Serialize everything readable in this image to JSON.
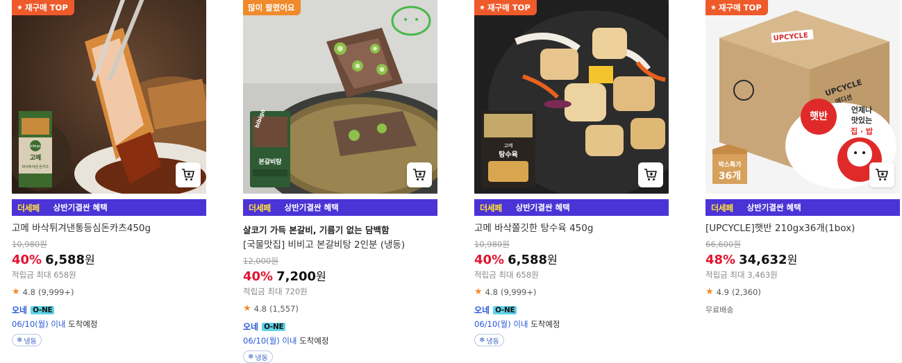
{
  "products": [
    {
      "badge": "재구매 TOP",
      "promo_logo": "더세페",
      "promo_text": "상반기결싼 혜택",
      "title": "고메 바삭튀겨낸통등심돈카츠450g",
      "original_price": "10,980원",
      "discount": "40%",
      "price": "6,588",
      "won": "원",
      "points": "적립금 최대 658원",
      "rating": "4.8",
      "reviews": "(9,999+)",
      "one_label": "오네",
      "one_logo": "O-NE",
      "arrival_date": "06/10(월) 이내",
      "arrival_rest": "도착예정",
      "frozen": "냉동",
      "image_text": [
        "bibigo",
        "고메",
        "바삭튀겨낸 돈카츠"
      ]
    },
    {
      "badge": "많이 팔렸어요",
      "promo_logo": "더세페",
      "promo_text": "상반기결싼 혜택",
      "subtitle": "살코기 가득 본갈비, 기름기 없는 담백함",
      "title": "[국물맛집] 비비고 본갈비탕 2인분 (냉동)",
      "original_price": "12,000원",
      "discount": "40%",
      "price": "7,200",
      "won": "원",
      "points": "적립금 최대 720원",
      "rating": "4.8",
      "reviews": "(1,557)",
      "one_label": "오네",
      "one_logo": "O-NE",
      "arrival_date": "06/10(월) 이내",
      "arrival_rest": "도착예정",
      "frozen": "냉동",
      "image_text": [
        "bibigo",
        "본갈비탕"
      ]
    },
    {
      "badge": "재구매 TOP",
      "promo_logo": "더세페",
      "promo_text": "상반기결싼 혜택",
      "title": "고메 바삭쫄깃한 탕수육 450g",
      "original_price": "10,980원",
      "discount": "40%",
      "price": "6,588",
      "won": "원",
      "points": "적립금 최대 658원",
      "rating": "4.8",
      "reviews": "(9,999+)",
      "one_label": "오네",
      "one_logo": "O-NE",
      "arrival_date": "06/10(월) 이내",
      "arrival_rest": "도착예정",
      "frozen": "냉동",
      "image_text": [
        "고메",
        "탕수육"
      ]
    },
    {
      "badge": "재구매 TOP",
      "promo_logo": "더세페",
      "promo_text": "상반기결싼 혜택",
      "title": "[UPCYCLE]햇반 210gx36개(1box)",
      "original_price": "66,600원",
      "discount": "48%",
      "price": "34,632",
      "won": "원",
      "points": "적립금 최대 3,463원",
      "rating": "4.9",
      "reviews": "(2,360)",
      "shipping": "무료배송",
      "image_text": [
        "UPCYCLE",
        "에디션",
        "햇반",
        "언제나",
        "맛있는",
        "집 · 밥",
        "박스특가",
        "36개"
      ]
    }
  ]
}
